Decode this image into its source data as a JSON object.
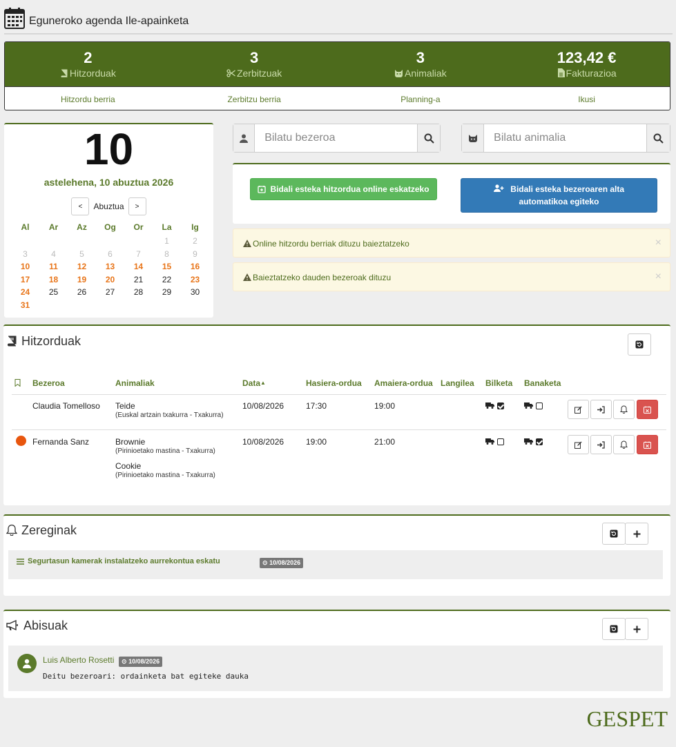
{
  "header": {
    "title": "Eguneroko agenda Ile-apainketa"
  },
  "stats": [
    {
      "value": "2",
      "label": "Hitzorduak",
      "icon": "book-icon"
    },
    {
      "value": "3",
      "label": "Zerbitzuak",
      "icon": "scissors-icon"
    },
    {
      "value": "3",
      "label": "Animaliak",
      "icon": "cat-icon"
    },
    {
      "value": "123,42 €",
      "label": "Fakturazioa",
      "icon": "file-icon"
    }
  ],
  "stat_links": [
    "Hitzordu berria",
    "Zerbitzu berria",
    "Planning-a",
    "Ikusi"
  ],
  "calendar": {
    "day": "10",
    "date_text": "astelehena, 10 abuztua 2026",
    "month": "Abuztua",
    "prev": "<",
    "next": ">",
    "weekdays": [
      "Al",
      "Ar",
      "Az",
      "Og",
      "Or",
      "La",
      "Ig"
    ],
    "days": [
      {
        "n": "",
        "t": "o"
      },
      {
        "n": "",
        "t": "o"
      },
      {
        "n": "",
        "t": "o"
      },
      {
        "n": "",
        "t": "o"
      },
      {
        "n": "",
        "t": "o"
      },
      {
        "n": "1",
        "t": "o"
      },
      {
        "n": "2",
        "t": "o"
      },
      {
        "n": "3",
        "t": "o"
      },
      {
        "n": "4",
        "t": "o"
      },
      {
        "n": "5",
        "t": "o"
      },
      {
        "n": "6",
        "t": "o"
      },
      {
        "n": "7",
        "t": "o"
      },
      {
        "n": "8",
        "t": "o"
      },
      {
        "n": "9",
        "t": "o"
      },
      {
        "n": "10",
        "t": "w"
      },
      {
        "n": "11",
        "t": "w"
      },
      {
        "n": "12",
        "t": "w"
      },
      {
        "n": "13",
        "t": "w"
      },
      {
        "n": "14",
        "t": "w"
      },
      {
        "n": "15",
        "t": "w"
      },
      {
        "n": "16",
        "t": "w"
      },
      {
        "n": "17",
        "t": "w"
      },
      {
        "n": "18",
        "t": "w"
      },
      {
        "n": "19",
        "t": "w"
      },
      {
        "n": "20",
        "t": "w"
      },
      {
        "n": "21",
        "t": "n"
      },
      {
        "n": "22",
        "t": "n"
      },
      {
        "n": "23",
        "t": "w"
      },
      {
        "n": "24",
        "t": "w"
      },
      {
        "n": "25",
        "t": "n"
      },
      {
        "n": "26",
        "t": "n"
      },
      {
        "n": "27",
        "t": "n"
      },
      {
        "n": "28",
        "t": "n"
      },
      {
        "n": "29",
        "t": "n"
      },
      {
        "n": "30",
        "t": "n"
      },
      {
        "n": "31",
        "t": "w"
      }
    ]
  },
  "search": {
    "client_placeholder": "Bilatu bezeroa",
    "animal_placeholder": "Bilatu animalia"
  },
  "actions": {
    "online_link": "Bidali esteka hitzordua online eskatzeko",
    "client_link": "Bidali esteka bezeroaren alta automatikoa egiteko"
  },
  "alerts": [
    "Online hitzordu berriak dituzu baieztatzeko",
    "Baieztatzeko dauden bezeroak dituzu"
  ],
  "appointments": {
    "title": "Hitzorduak",
    "columns": [
      "Bezeroa",
      "Animaliak",
      "Data",
      "Hasiera-ordua",
      "Amaiera-ordua",
      "Langilea",
      "Bilketa",
      "Banaketa"
    ],
    "sort_indicator": "▲",
    "rows": [
      {
        "client": "Claudia Tomelloso",
        "flag": false,
        "animals": [
          {
            "name": "Teide",
            "detail": "(Euskal artzain txakurra - Txakurra)"
          }
        ],
        "date": "10/08/2026",
        "start": "17:30",
        "end": "19:00",
        "staff": "",
        "pickup": true,
        "delivery": false
      },
      {
        "client": "Fernanda Sanz",
        "flag": true,
        "animals": [
          {
            "name": "Brownie",
            "detail": "(Pirinioetako mastina - Txakurra)"
          },
          {
            "name": "Cookie",
            "detail": "(Pirinioetako mastina - Txakurra)"
          }
        ],
        "date": "10/08/2026",
        "start": "19:00",
        "end": "21:00",
        "staff": "",
        "pickup": false,
        "delivery": true
      }
    ]
  },
  "tasks": {
    "title": "Zereginak",
    "items": [
      {
        "text": "Segurtasun kamerak instalatzeko aurrekontua eskatu",
        "date": "10/08/2026"
      }
    ]
  },
  "notices": {
    "title": "Abisuak",
    "items": [
      {
        "author": "Luis Alberto Rosetti",
        "date": "10/08/2026",
        "text": "Deitu bezeroari: ordainketa bat egiteke dauka"
      }
    ]
  },
  "brand": {
    "logo": "GESPET"
  },
  "colors": {
    "accent": "#4d6b1c",
    "accent_text": "#5b7a2b",
    "weekday_highlight": "#e8751a",
    "danger": "#d9534f",
    "primary": "#337ab7",
    "success": "#5cb85c"
  }
}
